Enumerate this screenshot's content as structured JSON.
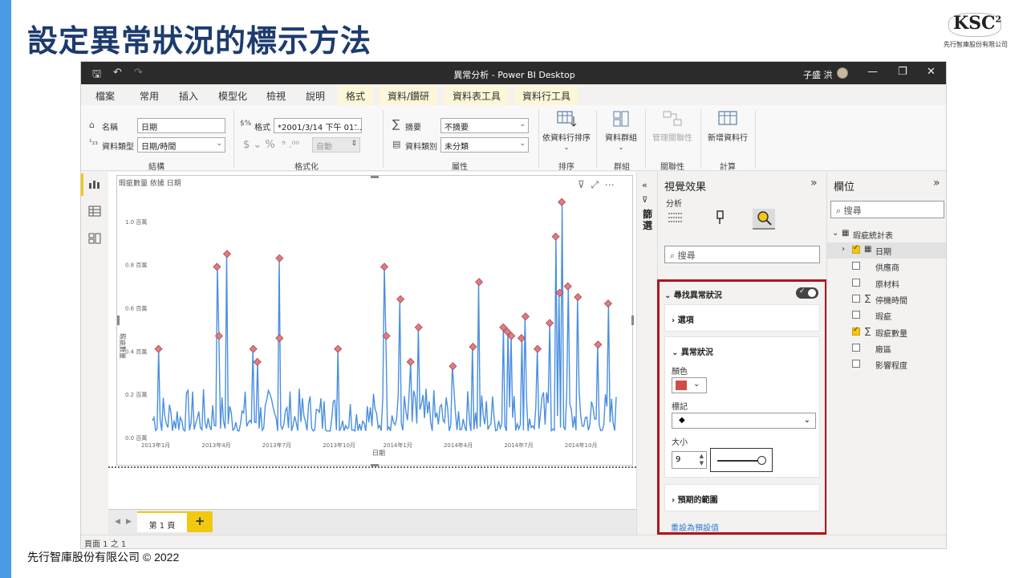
{
  "slide": {
    "title": "設定異常狀況的標示方法",
    "footer": "先行智庫股份有限公司 © 2022",
    "logo_text": "KSC",
    "logo_sup": "2",
    "logo_sub": "先行智庫股份有限公司"
  },
  "window": {
    "title": "異常分析 - Power BI Desktop",
    "user": "子盛 洪"
  },
  "tabs": [
    {
      "label": "檔案"
    },
    {
      "label": "常用"
    },
    {
      "label": "插入"
    },
    {
      "label": "模型化"
    },
    {
      "label": "檢視"
    },
    {
      "label": "說明"
    },
    {
      "label": "格式"
    },
    {
      "label": "資料/鑽研"
    },
    {
      "label": "資料表工具"
    },
    {
      "label": "資料行工具"
    }
  ],
  "ribbon": {
    "name_label": "名稱",
    "name_value": "日期",
    "datatype_label": "資料類型",
    "datatype_value": "日期/時間",
    "group_structure": "結構",
    "format_label": "格式",
    "format_value": "*2001/3/14 下午 01...",
    "format_symbols": "$ ⌄ %",
    "format_auto": "自動",
    "group_format": "格式化",
    "summary_label": "摘要",
    "summary_value": "不摘要",
    "category_label": "資料類別",
    "category_value": "未分類",
    "group_props": "屬性",
    "sort_label": "依資料行排序",
    "group_sort": "排序",
    "groups_label": "資料群組",
    "group_groups": "群組",
    "manage_rel_label": "管理關聯性",
    "group_rel": "關聯性",
    "new_col_label": "新增資料行",
    "group_calc": "計算"
  },
  "canvas": {
    "visual_title": "瑕疵數量 依據 日期",
    "page_tab": "第 1 頁",
    "page_add": "+",
    "status": "頁面 1 之 1"
  },
  "filters": {
    "label": "篩選"
  },
  "viz_pane": {
    "title": "視覺效果",
    "analytics": "分析",
    "search_placeholder": "搜尋",
    "find_anomalies": "尋找異常狀況",
    "options": "選項",
    "anomalies": "異常狀況",
    "color_label": "顏色",
    "marker_label": "標記",
    "marker_value": "◆",
    "size_label": "大小",
    "size_value": "9",
    "expected_range": "預期的範圍",
    "reset": "重設為預設值",
    "anomaly_color": "#d24b4b"
  },
  "fields_pane": {
    "title": "欄位",
    "search_placeholder": "搜尋",
    "table_name": "瑕疵統計表",
    "fields": [
      {
        "name": "日期",
        "checked": true,
        "sigma": false,
        "expanded": true
      },
      {
        "name": "供應商",
        "checked": false,
        "sigma": false
      },
      {
        "name": "原材料",
        "checked": false,
        "sigma": false
      },
      {
        "name": "停機時間",
        "checked": false,
        "sigma": true
      },
      {
        "name": "瑕疵",
        "checked": false,
        "sigma": false
      },
      {
        "name": "瑕疵數量",
        "checked": true,
        "sigma": true
      },
      {
        "name": "廠區",
        "checked": false,
        "sigma": false
      },
      {
        "name": "影響程度",
        "checked": false,
        "sigma": false
      }
    ]
  },
  "chart_data": {
    "type": "line",
    "title": "瑕疵數量 依據 日期",
    "xlabel": "日期",
    "ylabel": "瑕疵數量",
    "x_ticks": [
      "2013年1月",
      "2013年4月",
      "2013年7月",
      "2013年10月",
      "2014年1月",
      "2014年4月",
      "2014年7月",
      "2014年10月"
    ],
    "y_ticks": [
      "0.0 百萬",
      "0.2 百萬",
      "0.4 百萬",
      "0.6 百萬",
      "0.8 百萬",
      "1.0 百萬"
    ],
    "ylim": [
      0,
      1.1
    ],
    "x_range_months": [
      0,
      23
    ],
    "series_color": "#4a8fe0",
    "anomaly_color": "#e07b80",
    "anomalies": [
      {
        "month": 0.3,
        "value": 0.41
      },
      {
        "month": 3.2,
        "value": 0.79
      },
      {
        "month": 3.3,
        "value": 0.47
      },
      {
        "month": 3.7,
        "value": 0.85
      },
      {
        "month": 5.0,
        "value": 0.41
      },
      {
        "month": 5.2,
        "value": 0.35
      },
      {
        "month": 6.3,
        "value": 0.83
      },
      {
        "month": 6.3,
        "value": 0.46
      },
      {
        "month": 9.2,
        "value": 0.41
      },
      {
        "month": 11.5,
        "value": 0.79
      },
      {
        "month": 11.6,
        "value": 0.47
      },
      {
        "month": 12.3,
        "value": 0.64
      },
      {
        "month": 12.8,
        "value": 0.35
      },
      {
        "month": 13.2,
        "value": 0.51
      },
      {
        "month": 14.9,
        "value": 0.33
      },
      {
        "month": 15.9,
        "value": 0.42
      },
      {
        "month": 16.2,
        "value": 0.72
      },
      {
        "month": 17.4,
        "value": 0.51
      },
      {
        "month": 17.6,
        "value": 0.49
      },
      {
        "month": 17.8,
        "value": 0.47
      },
      {
        "month": 18.3,
        "value": 0.46
      },
      {
        "month": 18.5,
        "value": 0.56
      },
      {
        "month": 19.1,
        "value": 0.41
      },
      {
        "month": 19.7,
        "value": 0.53
      },
      {
        "month": 20.2,
        "value": 0.67
      },
      {
        "month": 20.3,
        "value": 1.09
      },
      {
        "month": 20.0,
        "value": 0.93
      },
      {
        "month": 20.6,
        "value": 0.7
      },
      {
        "month": 21.1,
        "value": 0.65
      },
      {
        "month": 22.1,
        "value": 0.43
      },
      {
        "month": 22.6,
        "value": 0.62
      }
    ]
  }
}
